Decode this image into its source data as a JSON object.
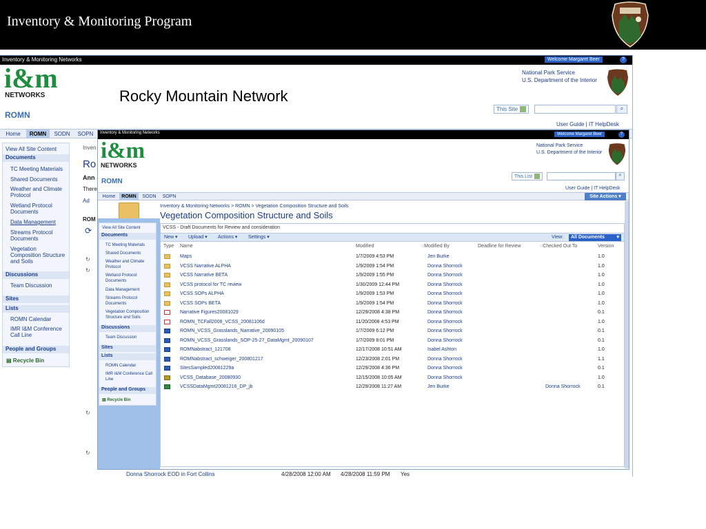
{
  "slide": {
    "title": "Inventory & Monitoring Program",
    "subtitle": "Rocky Mountain Network"
  },
  "back_window": {
    "chrome_title": "Inventory & Monitoring Networks",
    "welcome": "Welcome Margaret Beer",
    "logo": {
      "im": "i&m",
      "networks": "NETWORKS"
    },
    "site_name": "ROMN",
    "nps_line1": "National Park Service",
    "nps_line2": "U.S. Department of the Interior",
    "scope": "This Site",
    "user_links": "User Guide | IT HelpDesk",
    "tabs": [
      "Home",
      "ROMN",
      "SODN",
      "SOPN"
    ],
    "quick_launch": {
      "view_all": "View All Site Content",
      "documents": "Documents",
      "doc_items": [
        "TC Meeting Materials",
        "Shared Documents",
        "Weather and Climate Protocol",
        "Wetland Protocol Documents",
        "Data Management",
        "Streams Protocol Documents",
        "Vegetation Composition Structure and Soils"
      ],
      "discussions": "Discussions",
      "team_discussion": "Team Discussion",
      "sites": "Sites",
      "lists": "Lists",
      "list_items": [
        "ROMN Calendar",
        "IMR I&M Conference Call Line"
      ],
      "people": "People and Groups",
      "recycle": "Recycle Bin"
    },
    "partial_texts": [
      "Inven",
      "Ro",
      "Ann",
      "There",
      "Ad",
      "ROM"
    ],
    "footer_row": {
      "name": "Donna Shorrock EOD in Fort Collins",
      "start": "4/28/2008 12:00 AM",
      "end": "4/28/2008 11:59 PM",
      "allday": "Yes"
    }
  },
  "front_window": {
    "chrome_title": "Inventory & Monitoring Networks",
    "welcome": "Welcome Margaret Beer",
    "logo": {
      "im": "i&m",
      "networks": "NETWORKS"
    },
    "site_name": "ROMN",
    "nps_line1": "National Park Service",
    "nps_line2": "U.S. Department of the Interior",
    "scope": "This List",
    "user_links": "User Guide | IT HelpDesk",
    "site_actions": "Site Actions",
    "tabs": [
      "Home",
      "ROMN",
      "SODN",
      "SOPN"
    ],
    "breadcrumb": "Inventory & Monitoring Networks > ROMN > Vegetation Composition Structure and Soils",
    "doc_title": "Vegetation Composition Structure and Soils",
    "list_description": "VCSS - Draft Documents for Review and consideration",
    "toolbar": {
      "new": "New",
      "upload": "Upload",
      "actions": "Actions",
      "settings": "Settings",
      "view_label": "View:",
      "view_value": "All Documents"
    },
    "columns": [
      "Type",
      "Name",
      "Modified",
      "Modified By",
      "Deadline for Review",
      "Checked Out To",
      "Version"
    ],
    "quick_launch": {
      "view_all": "View All Site Content",
      "documents": "Documents",
      "doc_items": [
        "TC Meeting Materials",
        "Shared Documents",
        "Weather and Climate Protocol",
        "Wetland Protocol Documents",
        "Data Management",
        "Streams Protocol Documents",
        "Vegetation Composition Structure and Soils"
      ],
      "discussions": "Discussions",
      "team_discussion": "Team Discussion",
      "sites": "Sites",
      "lists": "Lists",
      "list_items": [
        "ROMN Calendar",
        "IMR I&M Conference Call Line"
      ],
      "people": "People and Groups",
      "recycle": "Recycle Bin"
    },
    "rows": [
      {
        "type": "folder",
        "name": "Maps",
        "modified": "1/7/2009 4:53 PM",
        "by": "Jen Burke",
        "checked_out": "",
        "version": "1.0"
      },
      {
        "type": "folder",
        "name": "VCSS Narrative ALPHA",
        "modified": "1/9/2009 1:54 PM",
        "by": "Donna Shorrock",
        "checked_out": "",
        "version": "1.0"
      },
      {
        "type": "folder",
        "name": "VCSS Narrative BETA",
        "modified": "1/9/2009 1:55 PM",
        "by": "Donna Shorrock",
        "checked_out": "",
        "version": "1.0"
      },
      {
        "type": "folder",
        "name": "VCSS protocol for TC review",
        "modified": "1/30/2009 12:44 PM",
        "by": "Donna Shorrock",
        "checked_out": "",
        "version": "1.0"
      },
      {
        "type": "folder",
        "name": "VCSS SOPs ALPHA",
        "modified": "1/9/2009 1:53 PM",
        "by": "Donna Shorrock",
        "checked_out": "",
        "version": "1.0"
      },
      {
        "type": "folder",
        "name": "VCSS SOPs BETA",
        "modified": "1/9/2009 1:54 PM",
        "by": "Donna Shorrock",
        "checked_out": "",
        "version": "1.0"
      },
      {
        "type": "pdf",
        "name": "Narrative Figures20081029",
        "modified": "12/29/2008 4:38 PM",
        "by": "Donna Shorrock",
        "checked_out": "",
        "version": "0.1"
      },
      {
        "type": "pdf",
        "name": "ROMN_TCFall2008_VCSS_20081106d",
        "modified": "11/20/2008 4:53 PM",
        "by": "Donna Shorrock",
        "checked_out": "",
        "version": "1.0"
      },
      {
        "type": "word",
        "name": "ROMN_VCSS_Grasslands_Narrative_20090105",
        "modified": "1/7/2009 6:12 PM",
        "by": "Donna Shorrock",
        "checked_out": "",
        "version": "0.1"
      },
      {
        "type": "word",
        "name": "ROMN_VCSS_Grasslands_SOP-25-27_DataMgmt_20090107",
        "modified": "1/7/2009 8:01 PM",
        "by": "Donna Shorrock",
        "checked_out": "",
        "version": "0.1"
      },
      {
        "type": "word",
        "name": "ROMNabstract_121708",
        "modified": "12/17/2008 10:51 AM",
        "by": "Isabel Ashton",
        "checked_out": "",
        "version": "1.0"
      },
      {
        "type": "word",
        "name": "ROMNabstract_schweiger_200801217",
        "modified": "12/23/2008 2:01 PM",
        "by": "Donna Shorrock",
        "checked_out": "",
        "version": "1.1"
      },
      {
        "type": "word",
        "name": "SitesSampled20081229a",
        "modified": "12/29/2008 4:36 PM",
        "by": "Donna Shorrock",
        "checked_out": "",
        "version": "0.1"
      },
      {
        "type": "access",
        "name": "VCSS_Database_20080930",
        "modified": "12/15/2008 10:05 AM",
        "by": "Donna Shorrock",
        "checked_out": "",
        "version": "1.0"
      },
      {
        "type": "excel",
        "name": "VCSSDataMgmt20081216_DP_jb",
        "modified": "12/29/2008 11:27 AM",
        "by": "Jen Burke",
        "checked_out": "Donna Shorrock",
        "version": "0.1"
      }
    ]
  }
}
